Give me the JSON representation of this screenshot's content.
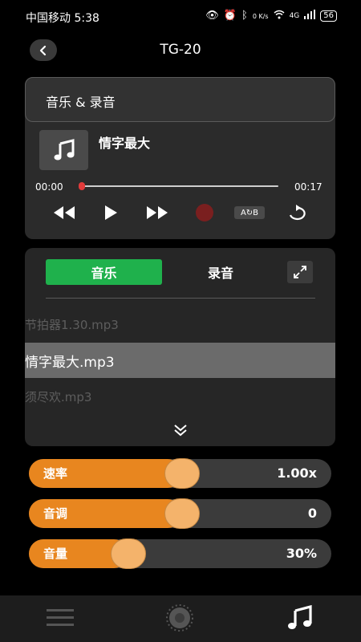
{
  "status_bar": {
    "carrier_time": "中国移动 5:38",
    "speed": "0 K/s",
    "network": "4G",
    "battery": "56"
  },
  "header": {
    "title": "TG-20"
  },
  "player": {
    "section_title": "音乐 & 录音",
    "track_title": "情字最大",
    "time_current": "00:00",
    "time_total": "00:17",
    "progress": 0.0,
    "ab_label": "A↻B"
  },
  "playlist": {
    "tabs": [
      {
        "label": "音乐",
        "active": true
      },
      {
        "label": "录音",
        "active": false
      }
    ],
    "items": [
      {
        "name": "节拍器1.30.mp3",
        "state": "dim"
      },
      {
        "name": "情字最大.mp3",
        "state": "selected"
      },
      {
        "name": "须尽欢.mp3",
        "state": "dim"
      }
    ]
  },
  "sliders": [
    {
      "label": "速率",
      "value": "1.00x",
      "level": 0.5
    },
    {
      "label": "音调",
      "value": "0",
      "level": 0.5
    },
    {
      "label": "音量",
      "value": "30%",
      "level": 0.3
    }
  ],
  "bottom_nav": {
    "items": [
      "menu-icon",
      "tuner-icon",
      "music-note-icon"
    ],
    "active": "music-note-icon"
  },
  "colors": {
    "accent_green": "#1fb14c",
    "slider_orange": "#e8861f",
    "knob": "#f4b36b",
    "record_red": "#7a1f1f",
    "progress_red": "#e23b3b"
  }
}
